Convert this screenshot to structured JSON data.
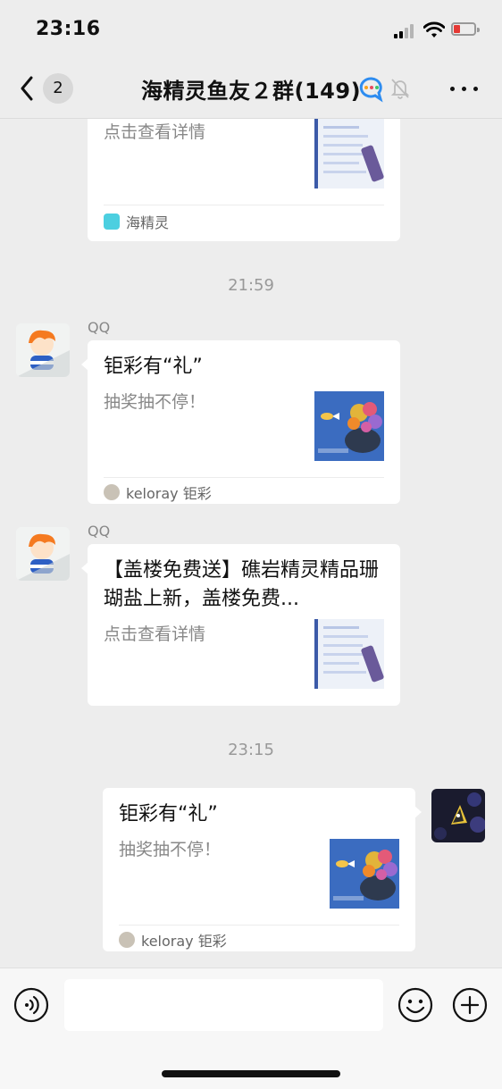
{
  "status_bar": {
    "time": "23:16"
  },
  "nav": {
    "unread_count": "2",
    "title": "海精灵鱼友２群(149)"
  },
  "messages": [
    {
      "desc": "点击查看详情",
      "source": "海精灵"
    },
    {
      "timestamp": "21:59"
    },
    {
      "sender": "QQ",
      "title": "钜彩有“礼”",
      "desc": "抽奖抽不停！",
      "source": "keloray 钜彩"
    },
    {
      "sender": "QQ",
      "title": "【盖楼免费送】礁岩精灵精品珊瑚盐上新，盖楼免费...",
      "desc": "点击查看详情"
    },
    {
      "timestamp": "23:15"
    },
    {
      "title": "钜彩有“礼”",
      "desc": "抽奖抽不停！",
      "source": "keloray 钜彩"
    }
  ],
  "input_bar": {
    "placeholder": ""
  },
  "colors": {
    "background": "#ededed",
    "card": "#ffffff",
    "muted_text": "#888888",
    "battery_low": "#e53935",
    "input_bar": "#f7f7f7"
  },
  "icons": [
    "back-chevron-icon",
    "chat-bubble-icon",
    "mute-bell-icon",
    "more-icon",
    "voice-icon",
    "emoji-icon",
    "plus-icon"
  ]
}
